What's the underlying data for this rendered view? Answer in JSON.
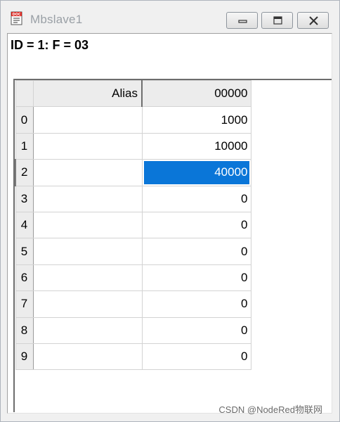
{
  "window": {
    "title": "Mbslave1"
  },
  "status": {
    "text": "ID = 1: F = 03"
  },
  "grid": {
    "headers": {
      "corner": "",
      "alias": "Alias",
      "address": "00000"
    },
    "rows": [
      {
        "index": "0",
        "alias": "",
        "value": "1000"
      },
      {
        "index": "1",
        "alias": "",
        "value": "10000"
      },
      {
        "index": "2",
        "alias": "",
        "value": "40000"
      },
      {
        "index": "3",
        "alias": "",
        "value": "0"
      },
      {
        "index": "4",
        "alias": "",
        "value": "0"
      },
      {
        "index": "5",
        "alias": "",
        "value": "0"
      },
      {
        "index": "6",
        "alias": "",
        "value": "0"
      },
      {
        "index": "7",
        "alias": "",
        "value": "0"
      },
      {
        "index": "8",
        "alias": "",
        "value": "0"
      },
      {
        "index": "9",
        "alias": "",
        "value": "0"
      }
    ],
    "selected_row": "2"
  },
  "watermark": {
    "text": "CSDN @NodeRed物联网"
  },
  "colors": {
    "selection": "#0a76d8",
    "header_bg": "#ececec",
    "title_text": "#9aa0a6"
  },
  "icons": {
    "app": "doc-icon",
    "minimize": "minimize-icon",
    "maximize": "maximize-icon",
    "close": "close-icon"
  }
}
